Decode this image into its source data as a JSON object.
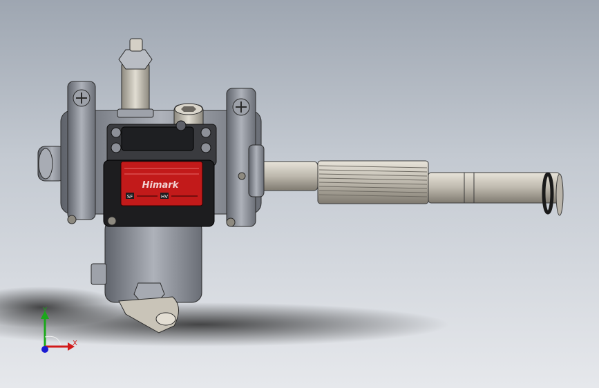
{
  "viewport": {
    "background_top": "#9ea6b1",
    "background_bottom": "#e6e8ec"
  },
  "model": {
    "label_plate": {
      "brand": "Himark",
      "color": "#c21a1a",
      "left_mark": "SF",
      "right_mark": "HV"
    },
    "body_color": "#8f939c",
    "shaft_color": "#bdb8ad"
  },
  "triad": {
    "y_label": "Y",
    "x_label": "X",
    "y_color": "#1aa81a",
    "x_color": "#d21a1a",
    "z_color": "#1a1ad2"
  }
}
